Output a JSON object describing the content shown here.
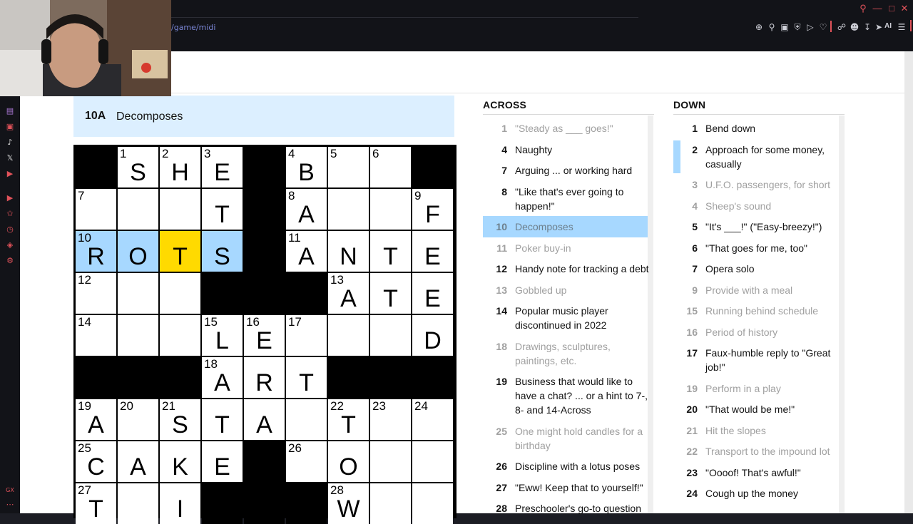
{
  "browser": {
    "url": "/game/midi",
    "ai_label": "AI"
  },
  "active_clue": {
    "number": "10A",
    "text": "Decomposes"
  },
  "grid": {
    "rows": 8,
    "cols": 9,
    "cells": [
      [
        {
          "b": 1
        },
        {
          "n": "1",
          "l": "S"
        },
        {
          "n": "2",
          "l": "H"
        },
        {
          "n": "3",
          "l": "E"
        },
        {
          "b": 1
        },
        {
          "n": "4",
          "l": "B"
        },
        {
          "n": "5",
          "l": ""
        },
        {
          "n": "6",
          "l": ""
        },
        {
          "b": 1
        }
      ],
      [
        {
          "n": "7",
          "l": ""
        },
        {
          "n": "",
          "l": ""
        },
        {
          "n": "",
          "l": ""
        },
        {
          "n": "",
          "l": "T"
        },
        {
          "b": 1
        },
        {
          "n": "8",
          "l": "A"
        },
        {
          "n": "",
          "l": ""
        },
        {
          "n": "",
          "l": ""
        },
        {
          "n": "9",
          "l": "F"
        }
      ],
      [
        {
          "n": "10",
          "l": "R",
          "h": 1
        },
        {
          "n": "",
          "l": "O",
          "h": 1
        },
        {
          "n": "",
          "l": "T",
          "c": 1
        },
        {
          "n": "",
          "l": "S",
          "h": 1
        },
        {
          "b": 1
        },
        {
          "n": "11",
          "l": "A"
        },
        {
          "n": "",
          "l": "N"
        },
        {
          "n": "",
          "l": "T"
        },
        {
          "n": "",
          "l": "E"
        }
      ],
      [
        {
          "n": "12",
          "l": ""
        },
        {
          "n": "",
          "l": ""
        },
        {
          "n": "",
          "l": ""
        },
        {
          "b": 1
        },
        {
          "b": 1
        },
        {
          "b": 1
        },
        {
          "n": "13",
          "l": "A"
        },
        {
          "n": "",
          "l": "T"
        },
        {
          "n": "",
          "l": "E"
        }
      ],
      [
        {
          "n": "14",
          "l": ""
        },
        {
          "n": "",
          "l": ""
        },
        {
          "n": "",
          "l": ""
        },
        {
          "n": "15",
          "l": "L"
        },
        {
          "n": "16",
          "l": "E"
        },
        {
          "n": "17",
          "l": ""
        },
        {
          "n": "",
          "l": ""
        },
        {
          "n": "",
          "l": ""
        },
        {
          "n": "",
          "l": "D"
        }
      ],
      [
        {
          "b": 1
        },
        {
          "b": 1
        },
        {
          "b": 1
        },
        {
          "n": "18",
          "l": "A"
        },
        {
          "n": "",
          "l": "R"
        },
        {
          "n": "",
          "l": "T"
        },
        {
          "b": 1
        },
        {
          "b": 1
        },
        {
          "b": 1
        }
      ],
      [
        {
          "n": "19",
          "l": "A"
        },
        {
          "n": "20",
          "l": ""
        },
        {
          "n": "21",
          "l": "S"
        },
        {
          "n": "",
          "l": "T"
        },
        {
          "n": "",
          "l": "A"
        },
        {
          "n": "",
          "l": ""
        },
        {
          "n": "22",
          "l": "T"
        },
        {
          "n": "23",
          "l": ""
        },
        {
          "n": "24",
          "l": ""
        }
      ],
      [
        {
          "n": "25",
          "l": "C"
        },
        {
          "n": "",
          "l": "A"
        },
        {
          "n": "",
          "l": "K"
        },
        {
          "n": "",
          "l": "E"
        },
        {
          "b": 1
        },
        {
          "n": "26",
          "l": ""
        },
        {
          "n": "",
          "l": "O"
        },
        {
          "n": "",
          "l": ""
        },
        {
          "n": "",
          "l": ""
        }
      ],
      [
        {
          "n": "27",
          "l": "T"
        },
        {
          "n": "",
          "l": ""
        },
        {
          "n": "",
          "l": "I"
        },
        {
          "b": 1
        },
        {
          "b": 1
        },
        {
          "b": 1
        },
        {
          "n": "28",
          "l": "W"
        },
        {
          "n": "",
          "l": ""
        },
        {
          "n": "",
          "l": ""
        }
      ]
    ]
  },
  "across": {
    "title": "ACROSS",
    "clues": [
      {
        "n": "1",
        "t": "\"Steady as ___ goes!\"",
        "dim": true
      },
      {
        "n": "4",
        "t": "Naughty"
      },
      {
        "n": "7",
        "t": "Arguing ... or working hard"
      },
      {
        "n": "8",
        "t": "\"Like that's ever going to happen!\"",
        "t2": "happen!\""
      },
      {
        "n": "10",
        "t": "Decomposes",
        "sel": true
      },
      {
        "n": "11",
        "t": "Poker buy-in",
        "dim": true
      },
      {
        "n": "12",
        "t": "Handy note for tracking a debt"
      },
      {
        "n": "13",
        "t": "Gobbled up",
        "dim": true
      },
      {
        "n": "14",
        "t": "Popular music player",
        "t2": "discontinued in 2022"
      },
      {
        "n": "18",
        "t": "Drawings, sculptures,",
        "t2": "paintings, etc.",
        "dim": true
      },
      {
        "n": "19",
        "t": "Business that would like to",
        "t2": "have a chat? ... or a hint to 7-,",
        "t3": "8- and 14-Across"
      },
      {
        "n": "25",
        "t": "One might hold candles for a",
        "t2": "birthday",
        "dim": true
      },
      {
        "n": "26",
        "t": "Discipline with a lotus poses"
      },
      {
        "n": "27",
        "t": "\"Eww! Keep that to yourself!\""
      },
      {
        "n": "28",
        "t": "Preschooler's go-to question"
      }
    ]
  },
  "down": {
    "title": "DOWN",
    "clues": [
      {
        "n": "1",
        "t": "Bend down"
      },
      {
        "n": "2",
        "t": "Approach for some money,",
        "t2": "casually",
        "marked": true
      },
      {
        "n": "3",
        "t": "U.F.O. passengers, for short",
        "dim": true
      },
      {
        "n": "4",
        "t": "Sheep's sound",
        "dim": true
      },
      {
        "n": "5",
        "t": "\"It's ___!\" (\"Easy-breezy!\")"
      },
      {
        "n": "6",
        "t": "\"That goes for me, too\""
      },
      {
        "n": "7",
        "t": "Opera solo"
      },
      {
        "n": "9",
        "t": "Provide with a meal",
        "dim": true
      },
      {
        "n": "15",
        "t": "Running behind schedule",
        "dim": true
      },
      {
        "n": "16",
        "t": "Period of history",
        "dim": true
      },
      {
        "n": "17",
        "t": "Faux-humble reply to \"Great",
        "t2": "job!\""
      },
      {
        "n": "19",
        "t": "Perform in a play",
        "dim": true
      },
      {
        "n": "20",
        "t": "\"That would be me!\""
      },
      {
        "n": "21",
        "t": "Hit the slopes",
        "dim": true
      },
      {
        "n": "22",
        "t": "Transport to the impound lot",
        "dim": true
      },
      {
        "n": "23",
        "t": "\"Oooof! That's awful!\""
      },
      {
        "n": "24",
        "t": "Cough up the money"
      }
    ]
  },
  "colors": {
    "highlight": "#a7d8ff",
    "current_cell": "#ffda00",
    "banner": "#dcefff"
  }
}
